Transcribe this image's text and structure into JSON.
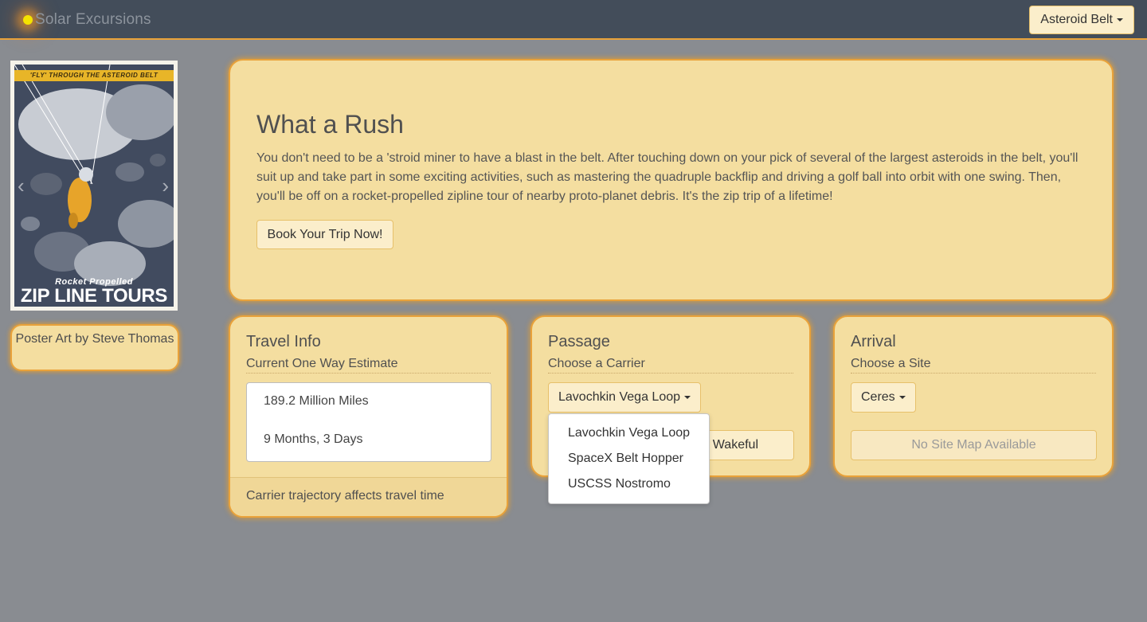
{
  "nav": {
    "brand": "Solar Excursions",
    "destination_label": "Asteroid Belt"
  },
  "poster": {
    "banner_text": "'FLY' THROUGH THE ASTEROID BELT",
    "subtitle": "Rocket Propelled",
    "title": "ZIP LINE TOURS",
    "credit": "Poster Art by  Steve Thomas"
  },
  "hero": {
    "title": "What a Rush",
    "description": "You don't need to be a 'stroid miner to have a blast in the belt. After touching down on your pick of several of the largest asteroids in the belt, you'll suit up and take part in some exciting activities, such as mastering the quadruple backflip and driving a golf ball into orbit with one swing. Then, you'll be off on a rocket-propelled zipline tour of nearby proto-planet debris. It's the zip trip of a lifetime!",
    "book_button": "Book Your Trip Now!"
  },
  "travel_info": {
    "title": "Travel Info",
    "subtitle": "Current One Way Estimate",
    "distance": "189.2 Million Miles",
    "duration": "9 Months, 3 Days",
    "footer": "Carrier trajectory affects travel time"
  },
  "passage": {
    "title": "Passage",
    "subtitle": "Choose a Carrier",
    "selected_carrier": "Lavochkin Vega Loop",
    "secondary_button": "Wakeful",
    "carrier_options": [
      "Lavochkin Vega Loop",
      "SpaceX Belt Hopper",
      "USCSS Nostromo"
    ]
  },
  "arrival": {
    "title": "Arrival",
    "subtitle": "Choose a Site",
    "selected_site": "Ceres",
    "site_map_button": "No Site Map Available"
  },
  "colors": {
    "navbar": "#434d5a",
    "background": "#898c91",
    "card": "#f4dea0",
    "accent_border": "#e9a23a"
  }
}
